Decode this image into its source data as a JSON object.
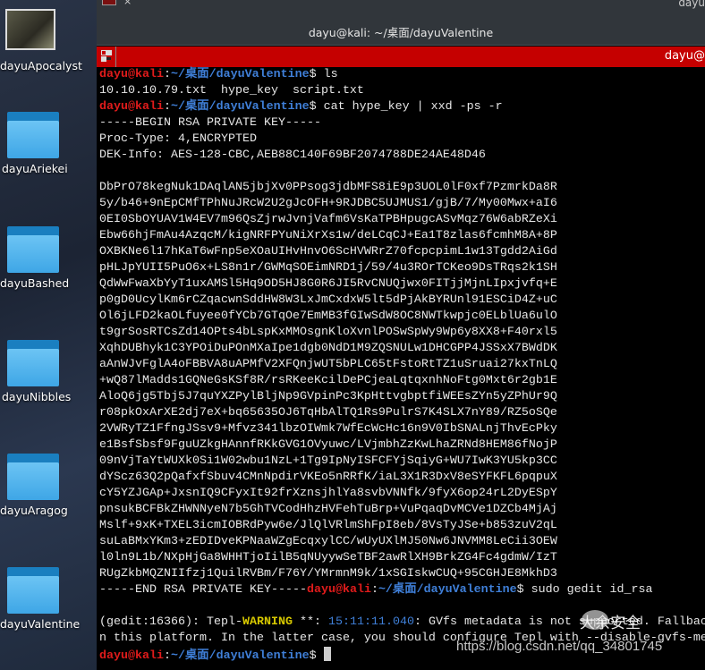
{
  "desktop": {
    "icons": [
      {
        "label": "dayuApocalyst",
        "type": "image"
      },
      {
        "label": "dayuAriekei",
        "type": "folder"
      },
      {
        "label": "dayuBashed",
        "type": "folder"
      },
      {
        "label": "dayuNibbles",
        "type": "folder"
      },
      {
        "label": "dayuAragog",
        "type": "folder"
      },
      {
        "label": "dayuValentine",
        "type": "folder"
      }
    ]
  },
  "window": {
    "title": "dayu@kali: ~/桌面/dayuValentine",
    "prev_tab_close": "×",
    "prev_name": "dayu",
    "tab_name": "dayu@"
  },
  "colors": {
    "tabbar": "#c50000",
    "user": "#e01b1b",
    "path": "#3f7fd8",
    "warning": "#d7c800"
  },
  "terminal": {
    "lines": [
      [
        {
          "t": "dayu@kali",
          "c": "u"
        },
        {
          "t": ":",
          "c": "n"
        },
        {
          "t": "~/桌面/dayuValentine",
          "c": "p"
        },
        {
          "t": "$ ls",
          "c": "n"
        }
      ],
      [
        {
          "t": "10.10.10.79.txt  hype_key  script.txt",
          "c": "n"
        }
      ],
      [
        {
          "t": "dayu@kali",
          "c": "u"
        },
        {
          "t": ":",
          "c": "n"
        },
        {
          "t": "~/桌面/dayuValentine",
          "c": "p"
        },
        {
          "t": "$ cat hype_key | xxd -ps -r",
          "c": "n"
        }
      ],
      [
        {
          "t": "-----BEGIN RSA PRIVATE KEY-----",
          "c": "n"
        }
      ],
      [
        {
          "t": "Proc-Type: 4,ENCRYPTED",
          "c": "n"
        }
      ],
      [
        {
          "t": "DEK-Info: AES-128-CBC,AEB88C140F69BF2074788DE24AE48D46",
          "c": "n"
        }
      ],
      [
        {
          "t": "",
          "c": "n"
        }
      ],
      [
        {
          "t": "DbPrO78kegNuk1DAqlAN5jbjXv0PPsog3jdbMFS8iE9p3UOL0lF0xf7PzmrkDa8R",
          "c": "n"
        }
      ],
      [
        {
          "t": "5y/b46+9nEpCMfTPhNuJRcW2U2gJcOFH+9RJDBC5UJMUS1/gjB/7/My00Mwx+aI6",
          "c": "n"
        }
      ],
      [
        {
          "t": "0EI0SbOYUAV1W4EV7m96QsZjrwJvnjVafm6VsKaTPBHpugcASvMqz76W6abRZeXi",
          "c": "n"
        }
      ],
      [
        {
          "t": "Ebw66hjFmAu4AzqcM/kigNRFPYuNiXrXs1w/deLCqCJ+Ea1T8zlas6fcmhM8A+8P",
          "c": "n"
        }
      ],
      [
        {
          "t": "OXBKNe6l17hKaT6wFnp5eXOaUIHvHnvO6ScHVWRrZ70fcpcpimL1w13Tgdd2AiGd",
          "c": "n"
        }
      ],
      [
        {
          "t": "pHLJpYUII5PuO6x+LS8n1r/GWMqSOEimNRD1j/59/4u3ROrTCKeo9DsTRqs2k1SH",
          "c": "n"
        }
      ],
      [
        {
          "t": "QdWwFwaXbYyT1uxAMSl5Hq9OD5HJ8G0R6JI5RvCNUQjwx0FITjjMjnLIpxjvfq+E",
          "c": "n"
        }
      ],
      [
        {
          "t": "p0gD0UcylKm6rCZqacwnSddHW8W3LxJmCxdxW5lt5dPjAkBYRUnl91ESCiD4Z+uC",
          "c": "n"
        }
      ],
      [
        {
          "t": "Ol6jLFD2kaOLfuyee0fYCb7GTqOe7EmMB3fGIwSdW8OC8NWTkwpjc0ELblUa6ulO",
          "c": "n"
        }
      ],
      [
        {
          "t": "t9grSosRTCsZd14OPts4bLspKxMMOsgnKloXvnlPOSwSpWy9Wp6y8XX8+F40rxl5",
          "c": "n"
        }
      ],
      [
        {
          "t": "XqhDUBhyk1C3YPOiDuPOnMXaIpe1dgb0NdD1M9ZQSNULw1DHCGPP4JSSxX7BWdDK",
          "c": "n"
        }
      ],
      [
        {
          "t": "aAnWJvFglA4oFBBVA8uAPMfV2XFQnjwUT5bPLC65tFstoRtTZ1uSruai27kxTnLQ",
          "c": "n"
        }
      ],
      [
        {
          "t": "+wQ87lMadds1GQNeGsKSf8R/rsRKeeKcilDePCjeaLqtqxnhNoFtg0Mxt6r2gb1E",
          "c": "n"
        }
      ],
      [
        {
          "t": "AloQ6jg5Tbj5J7quYXZPylBljNp9GVpinPc3KpHttvgbptfiWEEsZYn5yZPhUr9Q",
          "c": "n"
        }
      ],
      [
        {
          "t": "r08pkOxArXE2dj7eX+bq65635OJ6TqHbAlTQ1Rs9PulrS7K4SLX7nY89/RZ5oSQe",
          "c": "n"
        }
      ],
      [
        {
          "t": "2VWRyTZ1FfngJSsv9+Mfvz341lbzOIWmk7WfEcWcHc16n9V0IbSNALnjThvEcPky",
          "c": "n"
        }
      ],
      [
        {
          "t": "e1BsfSbsf9FguUZkgHAnnfRKkGVG1OVyuwc/LVjmbhZzKwLhaZRNd8HEM86fNojP",
          "c": "n"
        }
      ],
      [
        {
          "t": "09nVjTaYtWUXk0Si1W02wbu1NzL+1Tg9IpNyISFCFYjSqiyG+WU7IwK3YU5kp3CC",
          "c": "n"
        }
      ],
      [
        {
          "t": "dYScz63Q2pQafxfSbuv4CMnNpdirVKEo5nRRfK/iaL3X1R3DxV8eSYFKFL6pqpuX",
          "c": "n"
        }
      ],
      [
        {
          "t": "cY5YZJGAp+JxsnIQ9CFyxIt92frXznsjhlYa8svbVNNfk/9fyX6op24rL2DyESpY",
          "c": "n"
        }
      ],
      [
        {
          "t": "pnsukBCFBkZHWNNyeN7b5GhTVCodHhzHVFehTuBrp+VuPqaqDvMCVe1DZCb4MjAj",
          "c": "n"
        }
      ],
      [
        {
          "t": "Mslf+9xK+TXEL3icmIOBRdPyw6e/JlQlVRlmShFpI8eb/8VsTyJSe+b853zuV2qL",
          "c": "n"
        }
      ],
      [
        {
          "t": "suLaBMxYKm3+zEDIDveKPNaaWZgEcqxylCC/wUyUXlMJ50Nw6JNVMM8LeCii3OEW",
          "c": "n"
        }
      ],
      [
        {
          "t": "l0ln9L1b/NXpHjGa8WHHTjoIilB5qNUyywSeTBF2awRlXH9BrkZG4Fc4gdmW/IzT",
          "c": "n"
        }
      ],
      [
        {
          "t": "RUgZkbMQZNIIfzj1QuilRVBm/F76Y/YMrmnM9k/1xSGIskwCUQ+95CGHJE8MkhD3",
          "c": "n"
        }
      ],
      [
        {
          "t": "-----END RSA PRIVATE KEY-----",
          "c": "n"
        },
        {
          "t": "dayu@kali",
          "c": "u"
        },
        {
          "t": ":",
          "c": "n"
        },
        {
          "t": "~/桌面/dayuValentine",
          "c": "p"
        },
        {
          "t": "$ sudo gedit id_rsa",
          "c": "n"
        }
      ],
      [
        {
          "t": "",
          "c": "n"
        }
      ],
      [
        {
          "t": "(gedit:16366): Tepl-",
          "c": "n"
        },
        {
          "t": "WARNING",
          "c": "w"
        },
        {
          "t": " **: ",
          "c": "n"
        },
        {
          "t": "15:11:11.040",
          "c": "b"
        },
        {
          "t": ": GVfs metadata is not supported. Fallback",
          "c": "n"
        }
      ],
      [
        {
          "t": "n this platform. In the latter case, you should configure Tepl with --disable-gvfs-me",
          "c": "n"
        }
      ],
      [
        {
          "t": "dayu@kali",
          "c": "u"
        },
        {
          "t": ":",
          "c": "n"
        },
        {
          "t": "~/桌面/dayuValentine",
          "c": "p"
        },
        {
          "t": "$ ",
          "c": "n"
        }
      ]
    ]
  },
  "watermark": {
    "name": "大余安全",
    "url": "https://blog.csdn.net/qq_34801745"
  }
}
